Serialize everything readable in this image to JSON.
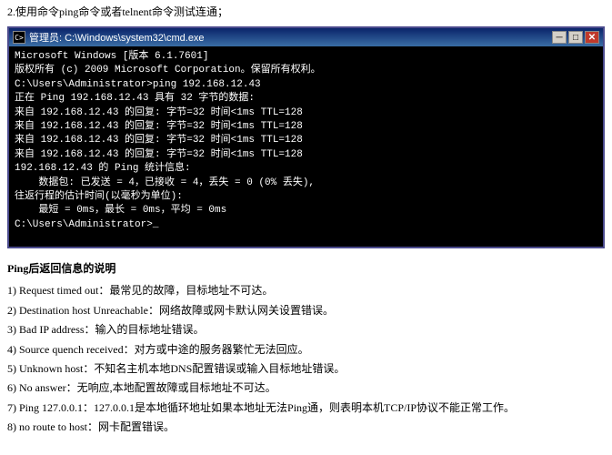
{
  "top_instruction": "2.使用命令ping命令或者telnent命令测试连通；",
  "cmd_window": {
    "title": "管理员: C:\\Windows\\system32\\cmd.exe",
    "icon_char": "C>",
    "btn_min": "0",
    "btn_max": "1",
    "btn_close": "r",
    "lines": [
      {
        "text": "Microsoft Windows [版本 6.1.7601]",
        "style": "white"
      },
      {
        "text": "版权所有 (c) 2009 Microsoft Corporation。保留所有权利。",
        "style": "white"
      },
      {
        "text": "",
        "style": "gray"
      },
      {
        "text": "C:\\Users\\Administrator>ping 192.168.12.43",
        "style": "white"
      },
      {
        "text": "",
        "style": "gray"
      },
      {
        "text": "正在 Ping 192.168.12.43 具有 32 字节的数据:",
        "style": "white"
      },
      {
        "text": "来自 192.168.12.43 的回复: 字节=32 时间<1ms TTL=128",
        "style": "white"
      },
      {
        "text": "来自 192.168.12.43 的回复: 字节=32 时间<1ms TTL=128",
        "style": "white"
      },
      {
        "text": "来自 192.168.12.43 的回复: 字节=32 时间<1ms TTL=128",
        "style": "white"
      },
      {
        "text": "来自 192.168.12.43 的回复: 字节=32 时间<1ms TTL=128",
        "style": "white"
      },
      {
        "text": "",
        "style": "gray"
      },
      {
        "text": "192.168.12.43 的 Ping 统计信息:",
        "style": "white"
      },
      {
        "text": "    数据包: 已发送 = 4，已接收 = 4，丢失 = 0 (0% 丢失),",
        "style": "white"
      },
      {
        "text": "往返行程的估计时间(以毫秒为单位):",
        "style": "white"
      },
      {
        "text": "    最短 = 0ms，最长 = 0ms，平均 = 0ms",
        "style": "white"
      },
      {
        "text": "",
        "style": "gray"
      },
      {
        "text": "C:\\Users\\Administrator>_",
        "style": "white"
      }
    ]
  },
  "ping_section": {
    "title": "Ping后返回信息的说明",
    "items": [
      {
        "number": "1)",
        "label": "Request timed out",
        "desc": "：最常见的故障，目标地址不可达。"
      },
      {
        "number": "2)",
        "label": "Destination host Unreachable",
        "desc": "：网络故障或网卡默认网关设置错误。"
      },
      {
        "number": "3)",
        "label": "Bad IP address",
        "desc": "：输入的目标地址错误。"
      },
      {
        "number": "4)",
        "label": "Source quench received",
        "desc": "：对方或中途的服务器繁忙无法回应。"
      },
      {
        "number": "5)",
        "label": "Unknown host",
        "desc": "：不知名主机本地DNS配置错误或输入目标地址错误。"
      },
      {
        "number": "6)",
        "label": "No answer",
        "desc": "：无响应,本地配置故障或目标地址不可达。"
      },
      {
        "number": "7)",
        "label": "Ping 127.0.0.1",
        "desc": "：127.0.0.1是本地循环地址如果本地址无法Ping通，则表明本机TCP/IP协议不能正常工作。"
      },
      {
        "number": "8)",
        "label": "no route to host",
        "desc": "：网卡配置错误。"
      }
    ]
  }
}
